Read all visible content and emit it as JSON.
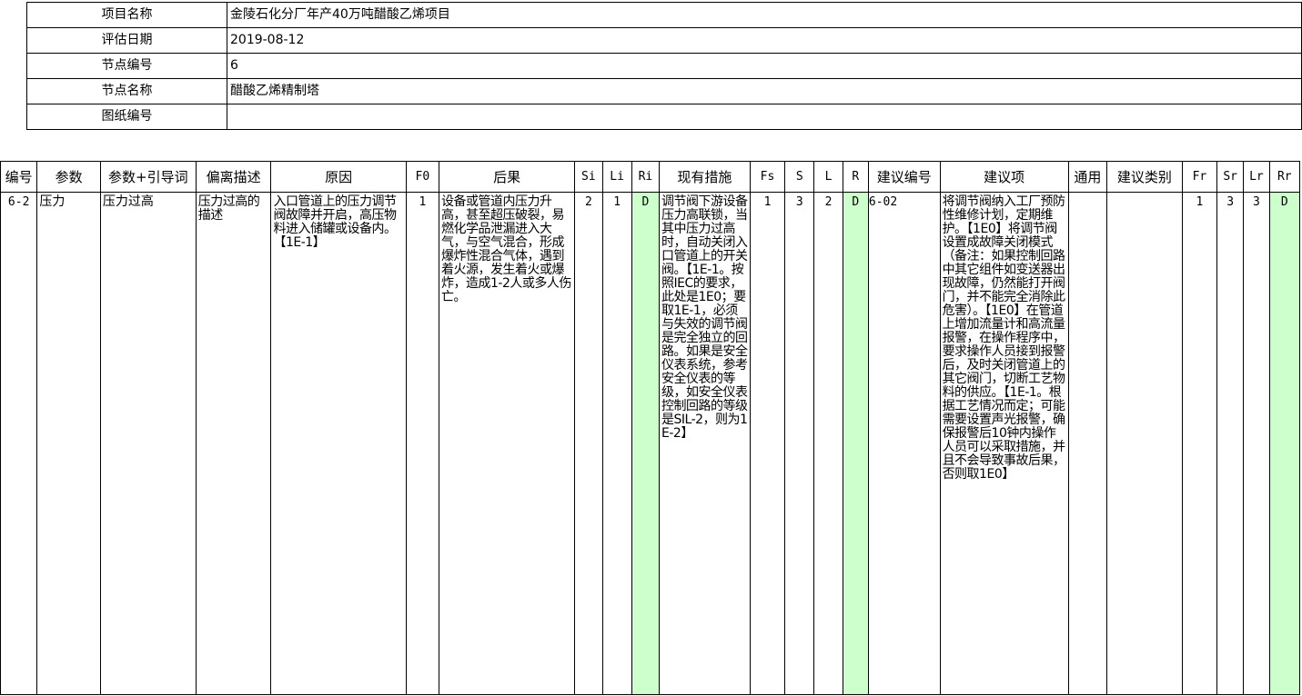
{
  "info": {
    "rows": [
      {
        "label": "项目名称",
        "value": "金陵石化分厂年产40万吨醋酸乙烯项目"
      },
      {
        "label": "评估日期",
        "value": "2019-08-12"
      },
      {
        "label": "节点编号",
        "value": "6"
      },
      {
        "label": "节点名称",
        "value": "醋酸乙烯精制塔"
      },
      {
        "label": "图纸编号",
        "value": ""
      }
    ]
  },
  "table": {
    "headers": [
      "编号",
      "参数",
      "参数+引导词",
      "偏离描述",
      "原因",
      "F0",
      "后果",
      "Si",
      "Li",
      "Ri",
      "现有措施",
      "Fs",
      "S",
      "L",
      "R",
      "建议编号",
      "建议项",
      "通用",
      "建议类别",
      "Fr",
      "Sr",
      "Lr",
      "Rr"
    ],
    "row": {
      "id": "6-2",
      "param": "压力",
      "param_guide": "压力过高",
      "deviation": "压力过高的描述",
      "cause": "入口管道上的压力调节阀故障并开启，高压物料进入储罐或设备内。【1E-1】",
      "f0": "1",
      "consequence": "设备或管道内压力升高，甚至超压破裂，易燃化学品泄漏进入大气，与空气混合，形成爆炸性混合气体，遇到着火源，发生着火或爆炸，造成1-2人或多人伤亡。",
      "si": "2",
      "li": "1",
      "ri": "D",
      "existing": "调节阀下游设备压力高联锁，当其中压力过高时，自动关闭入口管道上的开关阀。【1E-1。按照IEC的要求，此处是1E0；要取1E-1，必须与失效的调节阀是完全独立的回路。如果是安全仪表系统，参考安全仪表的等级，如安全仪表控制回路的等级是SIL-2，则为1E-2】",
      "fs": "1",
      "s": "3",
      "l": "2",
      "r": "D",
      "rec_id": "6-02",
      "recommendation": "将调节阀纳入工厂预防性维修计划，定期维护。【1E0】将调节阀设置成故障关闭模式（备注：如果控制回路中其它组件如变送器出现故障，仍然能打开阀门，并不能完全消除此危害）。【1E0】在管道上增加流量计和高流量报警，在操作程序中，要求操作人员接到报警后，及时关闭管道上的其它阀门，切断工艺物料的供应。【1E-1。根据工艺情况而定；可能需要设置声光报警，确保报警后10钟内操作人员可以采取措施，并且不会导致事故后果，否则取1E0】",
      "general": "",
      "rec_type": "",
      "fr": "1",
      "sr": "3",
      "lr": "3",
      "rr": "D"
    }
  },
  "colors": {
    "risk_cell": "#ccffcc",
    "border": "#000000"
  }
}
